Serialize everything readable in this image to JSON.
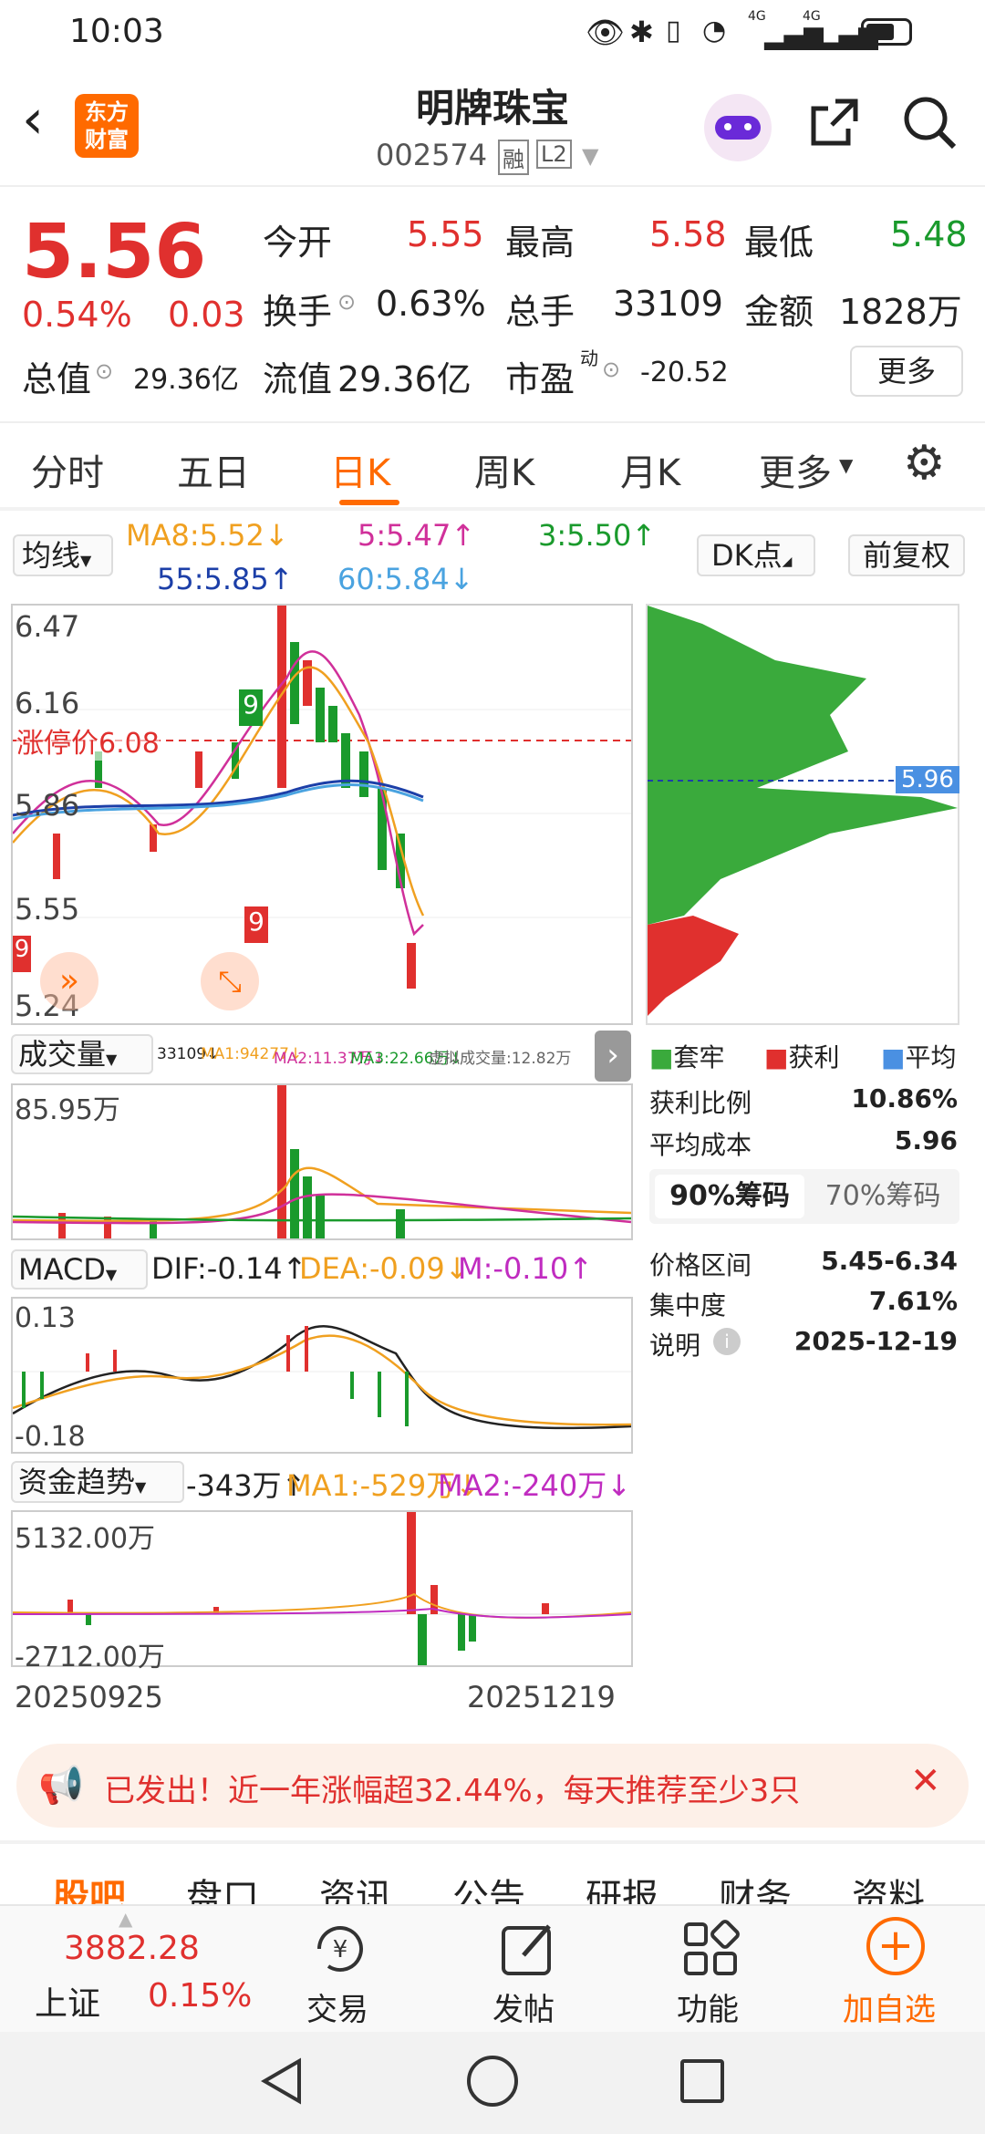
{
  "status": {
    "time": "10:03",
    "battery": "",
    "net1": "4G",
    "net2": "4G"
  },
  "header": {
    "logo_line1": "东方",
    "logo_line2": "财富",
    "name": "明牌珠宝",
    "code": "002574",
    "tag1": "融",
    "tag2": "L2"
  },
  "quote": {
    "price": "5.56",
    "pct": "0.54%",
    "chg": "0.03",
    "open_label": "今开",
    "open": "5.55",
    "high_label": "最高",
    "high": "5.58",
    "low_label": "最低",
    "low": "5.48",
    "turnover_label": "换手",
    "turnover": "0.63%",
    "vol_label": "总手",
    "vol": "33109",
    "amount_label": "金额",
    "amount": "1828万",
    "mcap_label": "总值",
    "mcap": "29.36亿",
    "float_label": "流值",
    "float": "29.36亿",
    "pe_label": "市盈",
    "pe_sup": "动",
    "pe": "-20.52",
    "more": "更多"
  },
  "tabs": [
    "分时",
    "五日",
    "日K",
    "周K",
    "月K",
    "更多"
  ],
  "ma": {
    "label": "均线",
    "ma8": "MA8:5.52↓",
    "ma5": "5:5.47↑",
    "ma3": "3:5.50↑",
    "ma55": "55:5.85↑",
    "ma60": "60:5.84↓",
    "dk": "DK点",
    "fq": "前复权"
  },
  "kchart": {
    "y_top": "6.47",
    "y_mid": "6.16",
    "y_ma": "5.86",
    "y_low2": "5.55",
    "y_bottom": "5.24",
    "limit_label": "涨停价6.08",
    "badge_a": "9",
    "badge_b": "9",
    "badge_c": "9"
  },
  "chip": {
    "cost_tag": "5.96",
    "legend1": "套牢",
    "legend2": "获利",
    "legend3": "平均",
    "profit_label": "获利比例",
    "profit": "10.86%",
    "cost_label": "平均成本",
    "cost": "5.96",
    "tab90": "90%筹码",
    "tab70": "70%筹码",
    "range_label": "价格区间",
    "range": "5.45-6.34",
    "conc_label": "集中度",
    "conc": "7.61%",
    "note_label": "说明",
    "date": "2025-12-19"
  },
  "volume": {
    "label": "成交量",
    "v": "33109↓",
    "ma1": "MA1:94277↓",
    "ma2": "MA2:11.37万↓",
    "ma3": "MA3:22.66万↓",
    "virtual": "虚拟成交量:12.82万",
    "max": "85.95万"
  },
  "macd": {
    "label": "MACD",
    "dif": "DIF:-0.14↑",
    "dea": "DEA:-0.09↓",
    "m": "M:-0.10↑",
    "top": "0.13",
    "bottom": "-0.18"
  },
  "fund": {
    "label": "资金趋势",
    "v": "-343万↑",
    "ma1": "MA1:-529万↓",
    "ma2": "MA2:-240万↓",
    "top": "5132.00万",
    "bottom": "-2712.00万"
  },
  "dates": {
    "start": "20250925",
    "end": "20251219"
  },
  "banner": {
    "text": "已发出！近一年涨幅超32.44%，每天推荐至少3只"
  },
  "subtabs": [
    "股吧",
    "盘口",
    "资讯",
    "公告",
    "研报",
    "财务",
    "资料"
  ],
  "bottom": {
    "index_value": "3882.28",
    "index_name": "上证",
    "index_pct": "0.15%",
    "trade": "交易",
    "post": "发帖",
    "func": "功能",
    "add": "加自选"
  },
  "colors": {
    "up": "#e0302e",
    "down": "#1a9a2c",
    "accent": "#ff6a00",
    "ma8": "#f0a020",
    "ma5": "#d0309a",
    "ma3": "#1a9a2c",
    "ma55": "#1c3fa8",
    "ma60": "#4aa3e0"
  }
}
